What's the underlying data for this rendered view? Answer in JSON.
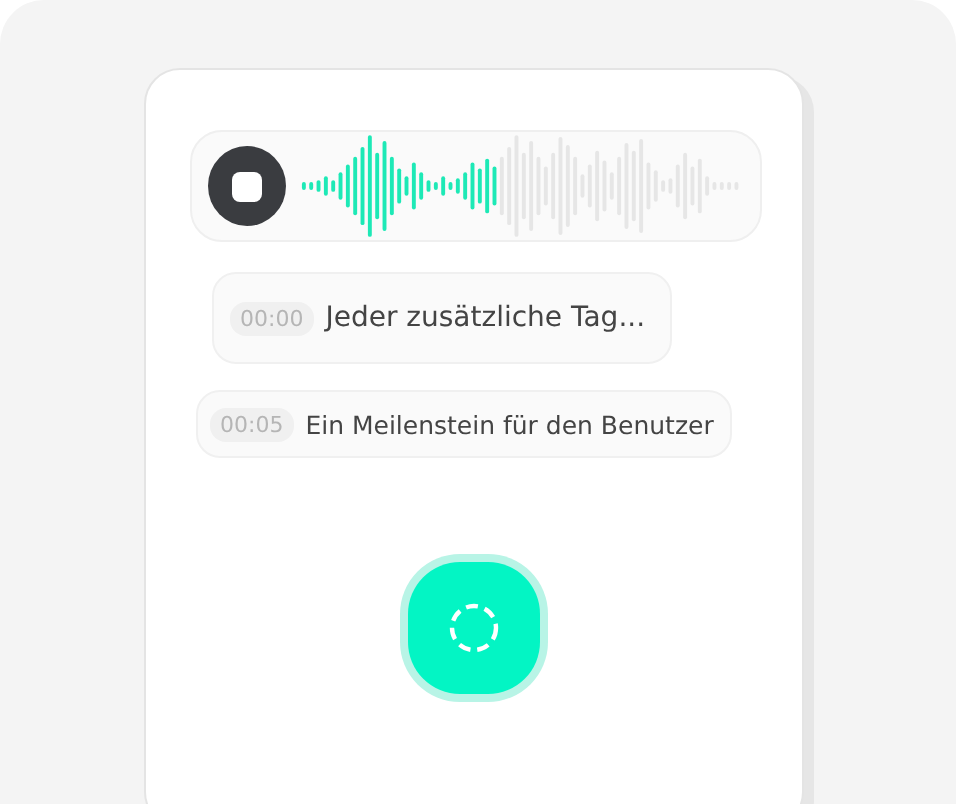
{
  "recorder": {
    "stop_button": true
  },
  "transcript": [
    {
      "kind": "live",
      "time": "00:00",
      "text": "Jeder zusätzliche Tag..."
    },
    {
      "kind": "final",
      "time": "00:05",
      "text": "Ein Meilenstein für den Benutzer"
    }
  ],
  "record_button": {
    "recording": true
  }
}
